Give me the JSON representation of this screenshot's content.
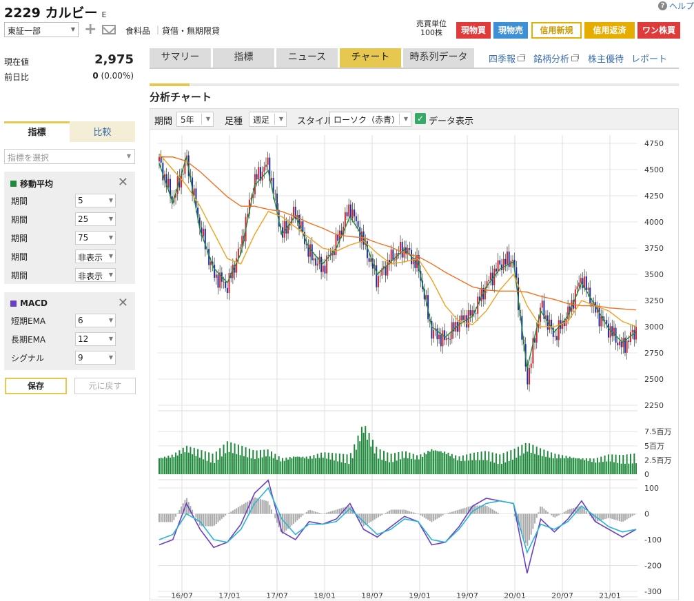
{
  "header": {
    "title": "2229 カルビー",
    "market_mark": "E",
    "help_label": "ヘルプ",
    "market": "東証一部",
    "sector": "食料品",
    "separator": "|",
    "lending": "貸借・無期限貸",
    "unit_label": "売買単位",
    "unit_value": "100株",
    "buttons": {
      "cash_buy": "現物買",
      "cash_sell": "現物売",
      "margin_new": "信用新規",
      "margin_close": "信用返済",
      "one_kabu": "ワン株買"
    }
  },
  "quote": {
    "price_label": "現在値",
    "price": "2,975",
    "change_label": "前日比",
    "change": "0",
    "change_pct": "(0.00%)"
  },
  "left_panel": {
    "tabs": [
      "指標",
      "比較"
    ],
    "indicator_placeholder": "指標を選択",
    "ma": {
      "title": "移動平均",
      "color": "#1f8a3c",
      "rows": [
        {
          "label": "期間",
          "value": "5"
        },
        {
          "label": "期間",
          "value": "25"
        },
        {
          "label": "期間",
          "value": "75"
        },
        {
          "label": "期間",
          "value": "非表示"
        },
        {
          "label": "期間",
          "value": "非表示"
        }
      ]
    },
    "macd": {
      "title": "MACD",
      "color": "#6a3fc0",
      "rows": [
        {
          "label": "短期EMA",
          "value": "6"
        },
        {
          "label": "長期EMA",
          "value": "12"
        },
        {
          "label": "シグナル",
          "value": "9"
        }
      ]
    },
    "save_label": "保存",
    "reset_label": "元に戻す"
  },
  "main_tabs": [
    {
      "label": "サマリー",
      "active": false
    },
    {
      "label": "指標",
      "active": false
    },
    {
      "label": "ニュース",
      "active": false
    },
    {
      "label": "チャート",
      "active": true
    },
    {
      "label": "時系列データ",
      "active": false
    }
  ],
  "main_links": [
    "四季報",
    "銘柄分析",
    "株主優待",
    "レポート"
  ],
  "section_title": "分析チャート",
  "chart_controls": {
    "period_label": "期間",
    "period_value": "5年",
    "bar_label": "足種",
    "bar_value": "週足",
    "style_label": "スタイル",
    "style_value": "ローソク（赤青）",
    "data_display_label": "データ表示",
    "data_display_checked": true
  },
  "chart_data": [
    {
      "type": "candlestick",
      "name": "price",
      "ylim": [
        2250,
        4750
      ],
      "yticks": [
        "4750",
        "4500",
        "4250",
        "4000",
        "3750",
        "3500",
        "3250",
        "3000",
        "2750",
        "2500",
        "2250"
      ],
      "xticks": [
        "16/07",
        "17/01",
        "17/07",
        "18/01",
        "18/07",
        "19/01",
        "19/07",
        "20/01",
        "20/07",
        "21/01"
      ],
      "up_color": "#d2262c",
      "down_color": "#1e2ea0",
      "series": [
        {
          "name": "MA5",
          "color": "#1f8a3c",
          "values": [
            4560,
            4180,
            4620,
            3920,
            3560,
            3420,
            3700,
            4350,
            4490,
            3880,
            4060,
            3750,
            3600,
            3750,
            4050,
            3850,
            3500,
            3620,
            3740,
            3600,
            3000,
            2900,
            3020,
            3100,
            3380,
            3550,
            3620,
            2600,
            3150,
            2950,
            3100,
            3420,
            3200,
            2980,
            2850,
            2950
          ]
        },
        {
          "name": "MA25",
          "color": "#f0a01e",
          "values": [
            4650,
            4500,
            4350,
            4150,
            3900,
            3650,
            3600,
            3880,
            4100,
            4050,
            3950,
            3850,
            3750,
            3720,
            3780,
            3820,
            3700,
            3600,
            3620,
            3650,
            3450,
            3200,
            3050,
            3020,
            3150,
            3350,
            3500,
            3200,
            3000,
            3000,
            3050,
            3250,
            3200,
            3150,
            3050,
            3000
          ]
        },
        {
          "name": "MA75",
          "color": "#f07020",
          "values": [
            4620,
            4620,
            4580,
            4480,
            4360,
            4240,
            4150,
            4150,
            4120,
            4100,
            4050,
            3990,
            3940,
            3880,
            3860,
            3850,
            3800,
            3760,
            3700,
            3670,
            3600,
            3520,
            3450,
            3380,
            3350,
            3340,
            3340,
            3330,
            3290,
            3260,
            3220,
            3200,
            3200,
            3180,
            3170,
            3160
          ]
        }
      ],
      "close": [
        4580,
        4200,
        4600,
        3950,
        3500,
        3380,
        3780,
        4400,
        4560,
        3870,
        4100,
        3700,
        3550,
        3800,
        4150,
        3800,
        3450,
        3650,
        3750,
        3580,
        2950,
        2870,
        3050,
        3120,
        3400,
        3600,
        3650,
        2480,
        3200,
        2900,
        3120,
        3480,
        3150,
        2980,
        2800,
        2975
      ]
    },
    {
      "type": "bar",
      "name": "volume",
      "yticks": [
        "7.5百万",
        "5百万",
        "2.5百万",
        "0"
      ],
      "ylim": [
        0,
        8500000
      ],
      "color": "#1f8a3c",
      "values": [
        2.8,
        3.2,
        4.5,
        3.6,
        2.7,
        4.9,
        4.2,
        3.4,
        3.8,
        2.5,
        3.1,
        2.9,
        3.4,
        3.0,
        2.6,
        8.2,
        3.7,
        2.8,
        3.5,
        2.9,
        4.3,
        3.8,
        2.7,
        3.1,
        3.3,
        2.6,
        3.5,
        4.8,
        3.9,
        3.2,
        3.0,
        2.7,
        2.4,
        2.9,
        2.6,
        2.8
      ]
    },
    {
      "type": "line",
      "name": "macd",
      "ylim": [
        -300,
        100
      ],
      "yticks": [
        "100",
        "0",
        "-100",
        "-200",
        "-300"
      ],
      "series": [
        {
          "name": "MACD",
          "color": "#6a3fc0",
          "values": [
            -120,
            -100,
            40,
            -60,
            -130,
            -110,
            -40,
            80,
            130,
            -70,
            -100,
            -30,
            -40,
            -20,
            40,
            -60,
            -90,
            -50,
            -10,
            -30,
            -120,
            -110,
            -50,
            30,
            60,
            50,
            40,
            -230,
            -20,
            -70,
            -20,
            50,
            -30,
            -60,
            -90,
            -60
          ]
        },
        {
          "name": "Signal",
          "color": "#28b4d2",
          "values": [
            -100,
            -80,
            0,
            -30,
            -100,
            -110,
            -60,
            40,
            100,
            -20,
            -80,
            -40,
            -40,
            -30,
            20,
            -30,
            -80,
            -60,
            -20,
            -30,
            -100,
            -110,
            -60,
            10,
            40,
            50,
            40,
            -150,
            -40,
            -60,
            -30,
            30,
            -10,
            -50,
            -70,
            -60
          ]
        }
      ],
      "histogram_color": "#aaaaaa"
    }
  ]
}
